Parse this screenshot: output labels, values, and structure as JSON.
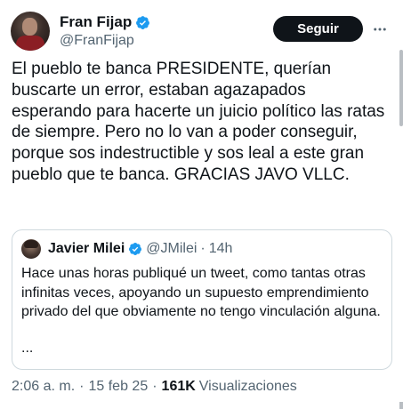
{
  "author": {
    "display_name": "Fran Fijap",
    "handle": "@FranFijap",
    "verified": true
  },
  "follow_button": {
    "label": "Seguir"
  },
  "more_menu": {
    "icon": "more-horizontal-icon"
  },
  "tweet": {
    "text": "El pueblo te banca PRESIDENTE, querían buscarte un error, estaban agazapados esperando para hacerte un juicio político las ratas de siempre. Pero no lo van a poder conseguir, porque sos indestructible y sos leal a este gran pueblo que te banca. GRACIAS JAVO VLLC."
  },
  "quoted_tweet": {
    "display_name": "Javier Milei",
    "handle": "@JMilei",
    "separator": "·",
    "time": "14h",
    "verified": true,
    "text": "Hace unas horas publiqué un tweet, como tantas otras infinitas veces, apoyando un supuesto emprendimiento privado del que obviamente no tengo vinculación alguna.",
    "ellipsis": "..."
  },
  "meta": {
    "time": "2:06 a. m.",
    "separator": "·",
    "date": "15 feb 25",
    "views_count": "161K",
    "views_label": "Visualizaciones"
  },
  "colors": {
    "text_primary": "#0f1419",
    "text_secondary": "#536471",
    "verified_blue": "#1d9bf0",
    "button_bg": "#0f1419",
    "border": "#cfd9de"
  }
}
